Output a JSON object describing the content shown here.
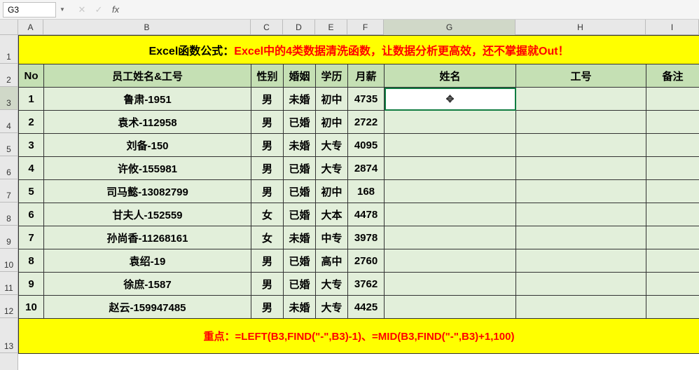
{
  "formula_bar": {
    "name_box": "G3",
    "formula_input": ""
  },
  "columns": [
    "A",
    "B",
    "C",
    "D",
    "E",
    "F",
    "G",
    "H",
    "I"
  ],
  "active_col": "G",
  "row_numbers": [
    1,
    2,
    3,
    4,
    5,
    6,
    7,
    8,
    9,
    10,
    11,
    12,
    13
  ],
  "active_row": 3,
  "banner": {
    "prefix": "Excel函数公式：",
    "main": "Excel中的4类数据清洗函数，让数据分析更高效，还不掌握就Out！"
  },
  "table": {
    "headers": [
      "No",
      "员工姓名&工号",
      "性别",
      "婚姻",
      "学历",
      "月薪",
      "姓名",
      "工号",
      "备注"
    ],
    "rows": [
      {
        "no": "1",
        "name": "鲁肃-1951",
        "sex": "男",
        "marry": "未婚",
        "edu": "初中",
        "salary": "4735",
        "xm": "",
        "gh": "",
        "bz": ""
      },
      {
        "no": "2",
        "name": "袁术-112958",
        "sex": "男",
        "marry": "已婚",
        "edu": "初中",
        "salary": "2722",
        "xm": "",
        "gh": "",
        "bz": ""
      },
      {
        "no": "3",
        "name": "刘备-150",
        "sex": "男",
        "marry": "未婚",
        "edu": "大专",
        "salary": "4095",
        "xm": "",
        "gh": "",
        "bz": ""
      },
      {
        "no": "4",
        "name": "许攸-155981",
        "sex": "男",
        "marry": "已婚",
        "edu": "大专",
        "salary": "2874",
        "xm": "",
        "gh": "",
        "bz": ""
      },
      {
        "no": "5",
        "name": "司马懿-13082799",
        "sex": "男",
        "marry": "已婚",
        "edu": "初中",
        "salary": "168",
        "xm": "",
        "gh": "",
        "bz": ""
      },
      {
        "no": "6",
        "name": "甘夫人-152559",
        "sex": "女",
        "marry": "已婚",
        "edu": "大本",
        "salary": "4478",
        "xm": "",
        "gh": "",
        "bz": ""
      },
      {
        "no": "7",
        "name": "孙尚香-11268161",
        "sex": "女",
        "marry": "未婚",
        "edu": "中专",
        "salary": "3978",
        "xm": "",
        "gh": "",
        "bz": ""
      },
      {
        "no": "8",
        "name": "袁绍-19",
        "sex": "男",
        "marry": "已婚",
        "edu": "高中",
        "salary": "2760",
        "xm": "",
        "gh": "",
        "bz": ""
      },
      {
        "no": "9",
        "name": "徐庶-1587",
        "sex": "男",
        "marry": "已婚",
        "edu": "大专",
        "salary": "3762",
        "xm": "",
        "gh": "",
        "bz": ""
      },
      {
        "no": "10",
        "name": "赵云-159947485",
        "sex": "男",
        "marry": "未婚",
        "edu": "大专",
        "salary": "4425",
        "xm": "",
        "gh": "",
        "bz": ""
      }
    ]
  },
  "footer": "重点：=LEFT(B3,FIND(\"-\",B3)-1)、=MID(B3,FIND(\"-\",B3)+1,100)",
  "col_widths": {
    "A": 36,
    "B": 296,
    "C": 46,
    "D": 46,
    "E": 46,
    "F": 52,
    "G": 188,
    "H": 186,
    "I": 76
  },
  "row_heights": {
    "1": 41,
    "2": 33,
    "3": 33,
    "4": 33,
    "5": 33,
    "6": 33,
    "7": 33,
    "8": 33,
    "9": 33,
    "10": 33,
    "11": 33,
    "12": 33,
    "13": 50
  }
}
